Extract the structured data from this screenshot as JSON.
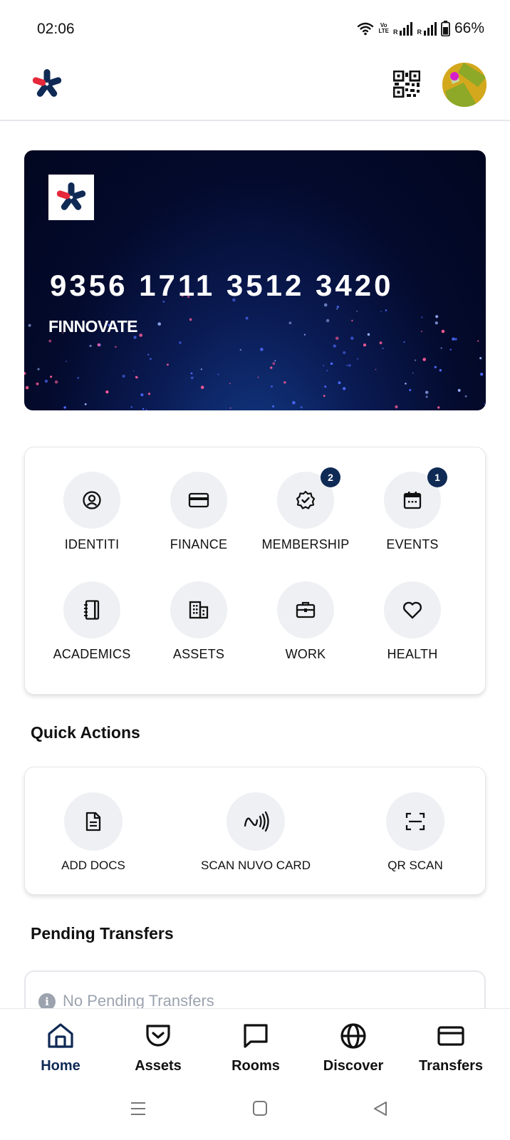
{
  "status_bar": {
    "time": "02:06",
    "volte_line1": "Vo",
    "volte_line2": "LTE",
    "sim1": "R",
    "sim2": "R",
    "battery": "66%"
  },
  "header": {
    "logo_icon": "asterisk-logo-icon",
    "qr_icon": "qr-code-icon",
    "avatar": "user-avatar"
  },
  "card": {
    "number": "9356 1711 3512 3420",
    "name": "FINNOVATE"
  },
  "categories": [
    {
      "label": "IDENTITI",
      "icon": "user-circle-icon",
      "badge": ""
    },
    {
      "label": "FINANCE",
      "icon": "credit-card-icon",
      "badge": ""
    },
    {
      "label": "MEMBERSHIP",
      "icon": "verified-badge-icon",
      "badge": "2"
    },
    {
      "label": "EVENTS",
      "icon": "calendar-icon",
      "badge": "1"
    },
    {
      "label": "ACADEMICS",
      "icon": "notebook-icon",
      "badge": ""
    },
    {
      "label": "ASSETS",
      "icon": "building-icon",
      "badge": ""
    },
    {
      "label": "WORK",
      "icon": "briefcase-icon",
      "badge": ""
    },
    {
      "label": "HEALTH",
      "icon": "heart-icon",
      "badge": ""
    }
  ],
  "quick_actions": {
    "title": "Quick Actions",
    "items": [
      {
        "label": "ADD DOCS",
        "icon": "document-icon"
      },
      {
        "label": "SCAN NUVO CARD",
        "icon": "nfc-icon"
      },
      {
        "label": "QR SCAN",
        "icon": "scan-icon"
      }
    ]
  },
  "pending": {
    "title": "Pending Transfers",
    "empty_text": "No Pending Transfers",
    "info_glyph": "i"
  },
  "bottom_nav": [
    {
      "label": "Home",
      "icon": "home-icon",
      "active": true
    },
    {
      "label": "Assets",
      "icon": "pocket-icon",
      "active": false
    },
    {
      "label": "Rooms",
      "icon": "chat-icon",
      "active": false
    },
    {
      "label": "Discover",
      "icon": "globe-icon",
      "active": false
    },
    {
      "label": "Transfers",
      "icon": "card-icon",
      "active": false
    }
  ],
  "colors": {
    "brand_navy": "#0f2a55",
    "brand_red": "#e5283a",
    "icon_circle": "#eef0f3",
    "muted_text": "#9ca3af"
  }
}
